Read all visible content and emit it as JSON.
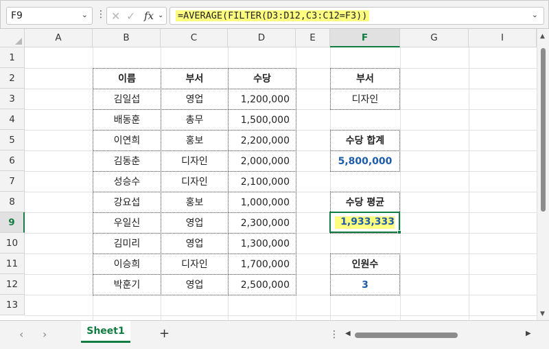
{
  "formula_bar": {
    "name_box": "F9",
    "formula": "=AVERAGE(FILTER(D3:D12,C3:C12=F3))"
  },
  "icons": {
    "cancel": "✕",
    "enter": "✓",
    "fx": "fx",
    "dropdown": "⌄",
    "more": "⋮"
  },
  "columns": [
    "A",
    "B",
    "C",
    "D",
    "E",
    "F",
    "G",
    "I"
  ],
  "rows": [
    "1",
    "2",
    "3",
    "4",
    "5",
    "6",
    "7",
    "8",
    "9",
    "10",
    "11",
    "12",
    "13"
  ],
  "table": {
    "headers": [
      "이름",
      "부서",
      "수당"
    ],
    "rows": [
      [
        "김일섭",
        "영업",
        "1,200,000"
      ],
      [
        "배동훈",
        "총무",
        "1,500,000"
      ],
      [
        "이연희",
        "홍보",
        "2,200,000"
      ],
      [
        "김동춘",
        "디자인",
        "2,000,000"
      ],
      [
        "성승수",
        "디자인",
        "2,100,000"
      ],
      [
        "강요섭",
        "홍보",
        "1,000,000"
      ],
      [
        "우일신",
        "영업",
        "2,300,000"
      ],
      [
        "김미리",
        "영업",
        "1,300,000"
      ],
      [
        "이승희",
        "디자인",
        "1,700,000"
      ],
      [
        "박훈기",
        "영업",
        "2,500,000"
      ]
    ]
  },
  "side": {
    "dept_label": "부서",
    "dept_value": "디자인",
    "sum_label": "수당 합계",
    "sum_value": "5,800,000",
    "avg_label": "수당 평균",
    "avg_value": "1,933,333",
    "count_label": "인원수",
    "count_value": "3"
  },
  "sheets": {
    "active": "Sheet1",
    "add": "+"
  },
  "colors": {
    "accent": "#107c41",
    "highlight": "#fdfd7f",
    "value_blue": "#1f5ca8"
  }
}
